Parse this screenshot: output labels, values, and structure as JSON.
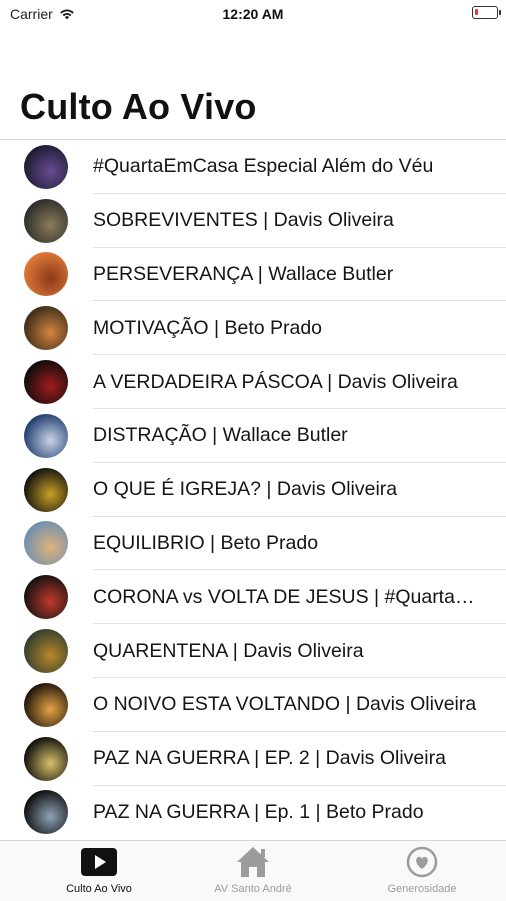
{
  "status": {
    "carrier": "Carrier",
    "time": "12:20 AM"
  },
  "title": "Culto Ao Vivo",
  "items": [
    {
      "label": "#QuartaEmCasa Especial Além do Véu",
      "thumb_colors": [
        "#1b1b2f",
        "#6a4c93"
      ]
    },
    {
      "label": "SOBREVIVENTES | Davis Oliveira",
      "thumb_colors": [
        "#2b2b2b",
        "#8b7d5a"
      ]
    },
    {
      "label": "PERSEVERANÇA | Wallace Butler",
      "thumb_colors": [
        "#e07b39",
        "#8b3a1a"
      ]
    },
    {
      "label": "MOTIVAÇÃO | Beto Prado",
      "thumb_colors": [
        "#3a2a1a",
        "#d4853f"
      ]
    },
    {
      "label": "A VERDADEIRA PÁSCOA | Davis Oliveira",
      "thumb_colors": [
        "#0d0d0d",
        "#a01b1b"
      ]
    },
    {
      "label": "DISTRAÇÃO | Wallace Butler",
      "thumb_colors": [
        "#1f3b6e",
        "#c8d4e6"
      ]
    },
    {
      "label": "O QUE É IGREJA? | Davis Oliveira",
      "thumb_colors": [
        "#0f0f0f",
        "#c9a227"
      ]
    },
    {
      "label": "EQUILIBRIO | Beto Prado",
      "thumb_colors": [
        "#6b8fb0",
        "#e0b27a"
      ]
    },
    {
      "label": "CORONA vs VOLTA DE JESUS | #QuartaEmCasa",
      "thumb_colors": [
        "#111111",
        "#c0392b"
      ]
    },
    {
      "label": "QUARENTENA | Davis Oliveira",
      "thumb_colors": [
        "#2f3e2f",
        "#b8862b"
      ]
    },
    {
      "label": "O NOIVO ESTA VOLTANDO | Davis Oliveira",
      "thumb_colors": [
        "#1a120b",
        "#e6a444"
      ]
    },
    {
      "label": "PAZ NA GUERRA | EP. 2 | Davis Oliveira",
      "thumb_colors": [
        "#0b0b0b",
        "#d9c26b"
      ]
    },
    {
      "label": "PAZ NA GUERRA | Ep. 1 | Beto Prado",
      "thumb_colors": [
        "#0b0b0b",
        "#8fa3b8"
      ]
    }
  ],
  "tabs": [
    {
      "label": "Culto Ao Vivo",
      "icon": "play-icon",
      "active": true
    },
    {
      "label": "AV Santo André",
      "icon": "home-icon",
      "active": false
    },
    {
      "label": "Generosidade",
      "icon": "heart-icon",
      "active": false
    }
  ],
  "colors": {
    "active_tab": "#111111",
    "inactive_tab": "#9c9c9c",
    "battery_low": "#e53935"
  }
}
